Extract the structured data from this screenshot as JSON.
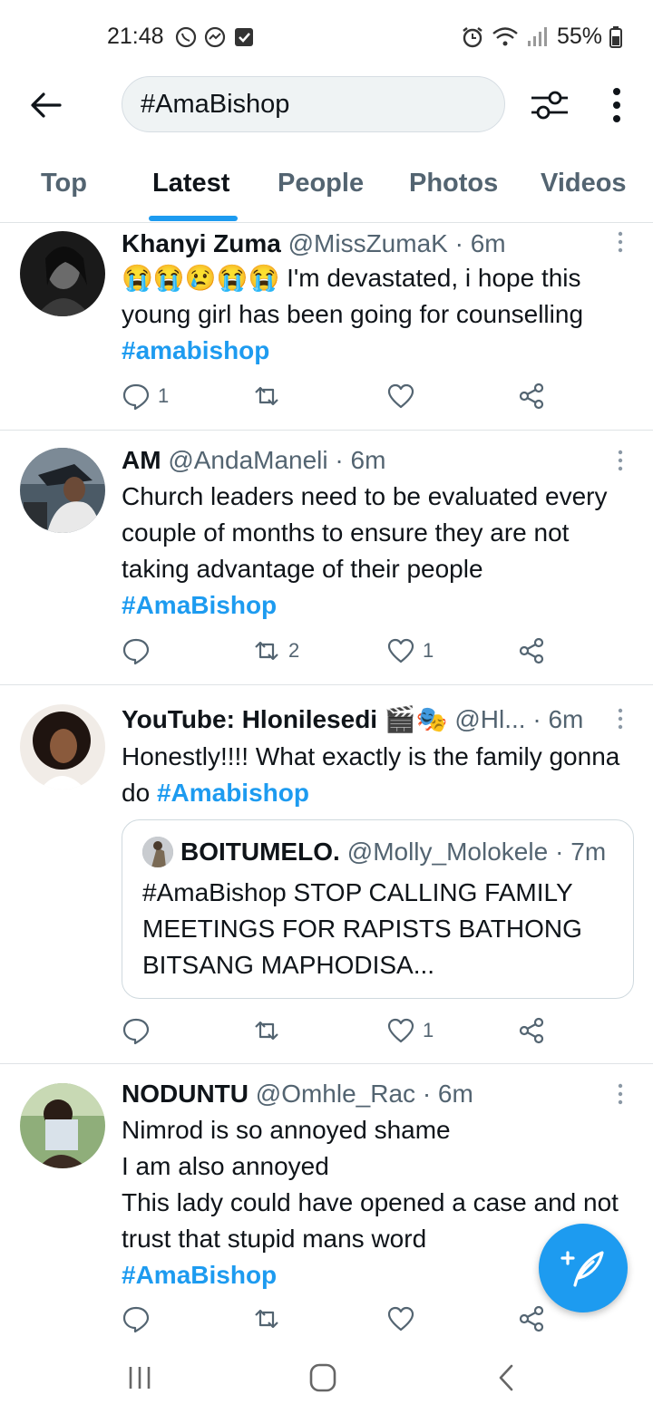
{
  "status_bar": {
    "time": "21:48",
    "battery": "55%"
  },
  "search": {
    "query": "#AmaBishop"
  },
  "tabs": [
    {
      "label": "Top",
      "active": false
    },
    {
      "label": "Latest",
      "active": true
    },
    {
      "label": "People",
      "active": false
    },
    {
      "label": "Photos",
      "active": false
    },
    {
      "label": "Videos",
      "active": false
    }
  ],
  "tweets": [
    {
      "name": "Khanyi Zuma",
      "handle": "@MissZumaK",
      "time": "· 6m",
      "emojis": "😭😭😢😭😭",
      "text": " I'm devastated, i hope this young girl has been going for counselling",
      "hashtag": "#amabishop",
      "replies": "1",
      "retweets": "",
      "likes": ""
    },
    {
      "name": "AM",
      "handle": "@AndaManeli",
      "time": "· 6m",
      "text": "Church leaders need to be evaluated every couple of months to ensure they are not taking advantage of their people",
      "hashtag": "#AmaBishop",
      "replies": "",
      "retweets": "2",
      "likes": "1"
    },
    {
      "name": "YouTube: Hlonilesedi",
      "name_emojis": "🎬🎭",
      "handle": "@Hl...",
      "time": "· 6m",
      "text": "Honestly!!!! What exactly is the family gonna do ",
      "hashtag": "#Amabishop",
      "quote": {
        "name": "BOITUMELO.",
        "handle": "@Molly_Molokele",
        "time": "· 7m",
        "text": "#AmaBishop STOP CALLING FAMILY MEETINGS FOR RAPISTS BATHONG BITSANG MAPHODISA..."
      },
      "replies": "",
      "retweets": "",
      "likes": "1"
    },
    {
      "name": "NODUNTU",
      "handle": "@Omhle_Rac",
      "time": "· 6m",
      "lines": [
        "Nimrod is so annoyed shame",
        "I am also annoyed",
        "This lady could have opened a case and not trust that stupid mans word"
      ],
      "hashtag": "#AmaBishop",
      "replies": "",
      "retweets": "",
      "likes": ""
    }
  ],
  "colors": {
    "accent": "#1d9bf0",
    "text": "#0f1419",
    "muted": "#536471",
    "divider": "#dfe3e6"
  },
  "icons": {
    "back": "arrow-left-icon",
    "filter": "sliders-icon",
    "more": "more-vertical-icon",
    "reply": "reply-icon",
    "retweet": "retweet-icon",
    "like": "heart-icon",
    "share": "share-icon",
    "compose": "compose-tweet-icon"
  }
}
